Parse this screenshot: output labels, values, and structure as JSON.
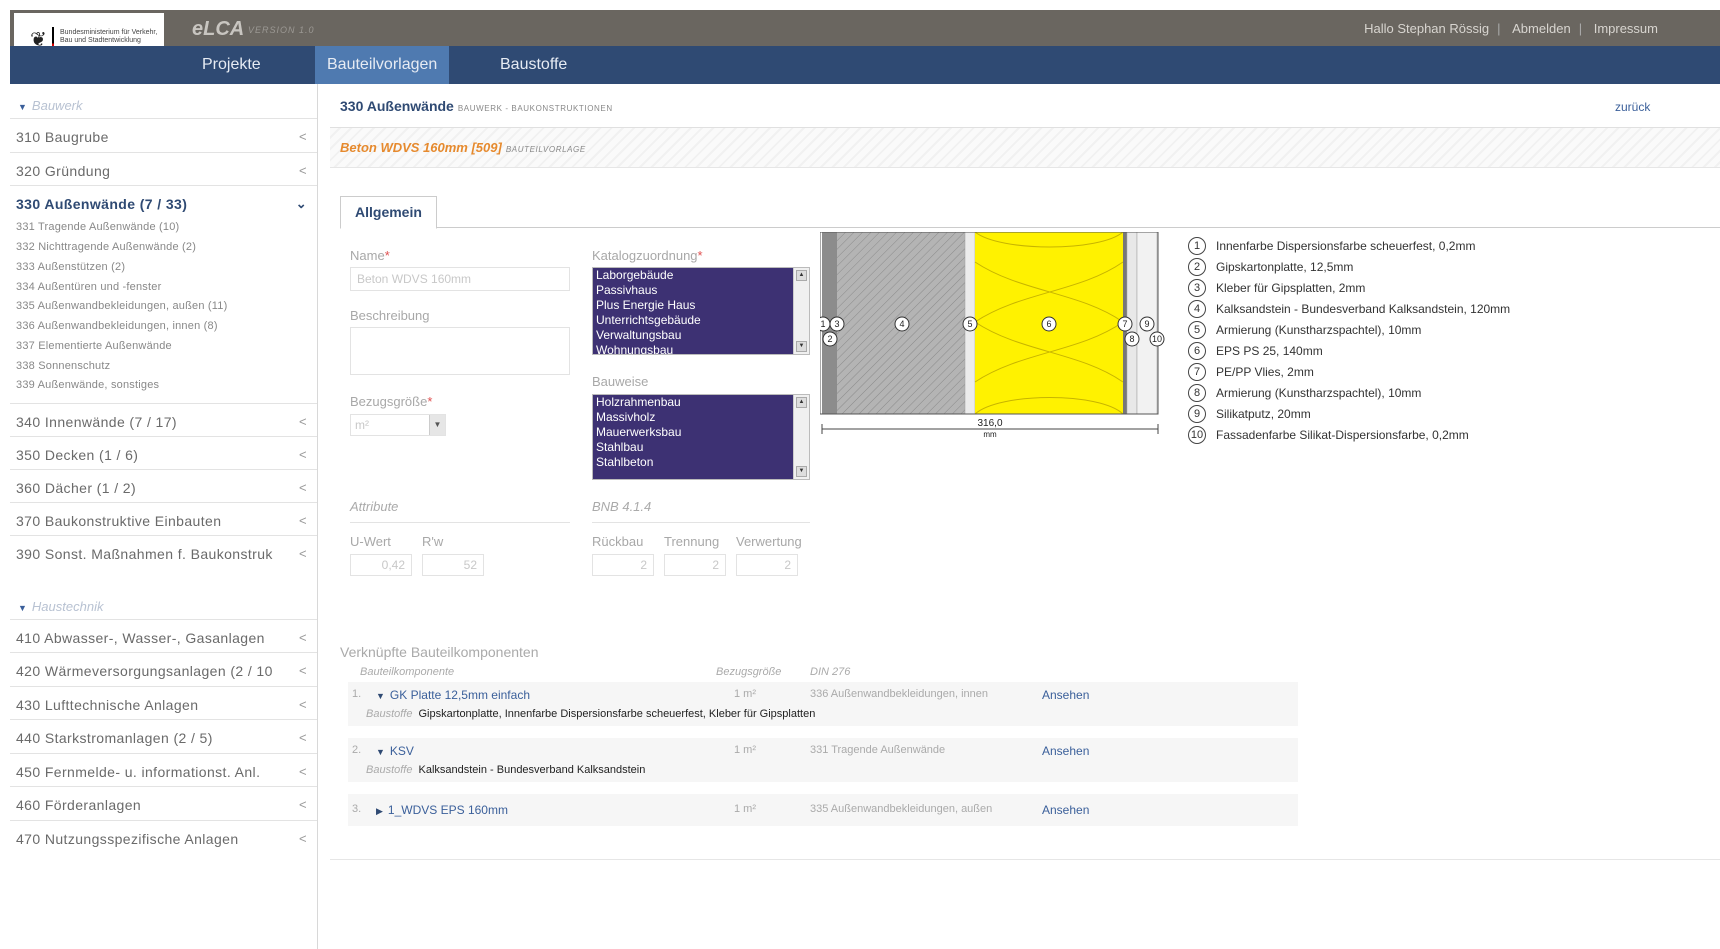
{
  "header": {
    "logo_text": "Bundesministerium für Verkehr, Bau und Stadtentwicklung",
    "logo_icon": "eagle-icon",
    "app_title": "eLCA",
    "app_version": "VERSION 1.0",
    "greeting": "Hallo Stephan Rössig",
    "logout": "Abmelden",
    "imprint": "Impressum"
  },
  "nav": {
    "projekte": "Projekte",
    "bauteilvorlagen": "Bauteilvorlagen",
    "baustoffe": "Baustoffe"
  },
  "sidebar": {
    "section1": "Bauwerk",
    "items1": [
      {
        "label": "310 Baugrube"
      },
      {
        "label": "320 Gründung"
      },
      {
        "label": "330 Außenwände (7 / 33)"
      }
    ],
    "subitems": [
      "331 Tragende Außenwände (10)",
      "332 Nichttragende Außenwände (2)",
      "333 Außenstützen (2)",
      "334 Außentüren und -fenster",
      "335 Außenwandbekleidungen, außen (11)",
      "336 Außenwandbekleidungen, innen (8)",
      "337 Elementierte Außenwände",
      "338 Sonnenschutz",
      "339 Außenwände, sonstiges"
    ],
    "items2": [
      {
        "label": "340 Innenwände (7 / 17)"
      },
      {
        "label": "350 Decken (1 / 6)"
      },
      {
        "label": "360 Dächer (1 / 2)"
      },
      {
        "label": "370 Baukonstruktive Einbauten"
      },
      {
        "label": "390 Sonst. Maßnahmen f. Baukonstruk"
      }
    ],
    "section2": "Haustechnik",
    "items3": [
      {
        "label": "410 Abwasser-, Wasser-, Gasanlagen"
      },
      {
        "label": "420 Wärmeversorgungsanlagen (2 / 10"
      },
      {
        "label": "430 Lufttechnische Anlagen"
      },
      {
        "label": "440 Starkstromanlagen (2 / 5)"
      },
      {
        "label": "450 Fernmelde- u. informationst. Anl."
      },
      {
        "label": "460 Förderanlagen"
      },
      {
        "label": "470 Nutzungsspezifische Anlagen"
      }
    ]
  },
  "breadcrumb": {
    "title": "330 Außenwände",
    "subtitle": "BAUWERK - BAUKONSTRUKTIONEN",
    "back": "zurück"
  },
  "template": {
    "title": "Beton WDVS 160mm [509]",
    "subtitle": "BAUTEILVORLAGE"
  },
  "tabs": {
    "allgemein": "Allgemein"
  },
  "form": {
    "name_label": "Name",
    "name_value": "Beton WDVS 160mm",
    "description_label": "Beschreibung",
    "unit_label": "Bezugsgröße",
    "unit_value": "m²",
    "catalog_label": "Katalogzuordnung",
    "catalog_options": [
      "Laborgebäude",
      "Passivhaus",
      "Plus Energie Haus",
      "Unterrichtsgebäude",
      "Verwaltungsbau",
      "Wohnungsbau"
    ],
    "construction_label": "Bauweise",
    "construction_options": [
      "Holzrahmenbau",
      "Massivholz",
      "Mauerwerksbau",
      "Stahlbau",
      "Stahlbeton"
    ],
    "required_mark": "*"
  },
  "attributes": {
    "header": "Attribute",
    "uwert_label": "U-Wert",
    "uwert_value": "0,42",
    "rw_label": "R'w",
    "rw_value": "52",
    "bnb_header": "BNB 4.1.4",
    "rueckbau_label": "Rückbau",
    "rueckbau_value": "2",
    "trennung_label": "Trennung",
    "trennung_value": "2",
    "verwertung_label": "Verwertung",
    "verwertung_value": "2"
  },
  "diagram": {
    "dimension_value": "316,0",
    "dimension_unit": "mm",
    "layer_colors": {
      "gray": "#8c8c8c",
      "concrete": "#b4b4b4",
      "white": "#ececec",
      "insulation": "#fff200"
    },
    "callouts": [
      "1",
      "2",
      "3",
      "4",
      "5",
      "6",
      "7",
      "8",
      "9",
      "10"
    ]
  },
  "legend": [
    {
      "num": "1",
      "text": "Innenfarbe Dispersionsfarbe scheuerfest, 0,2mm"
    },
    {
      "num": "2",
      "text": "Gipskartonplatte, 12,5mm"
    },
    {
      "num": "3",
      "text": "Kleber für Gipsplatten, 2mm"
    },
    {
      "num": "4",
      "text": "Kalksandstein - Bundesverband Kalksandstein, 120mm"
    },
    {
      "num": "5",
      "text": "Armierung (Kunstharzspachtel), 10mm"
    },
    {
      "num": "6",
      "text": "EPS PS 25, 140mm"
    },
    {
      "num": "7",
      "text": "PE/PP Vlies, 2mm"
    },
    {
      "num": "8",
      "text": "Armierung (Kunstharzspachtel), 10mm"
    },
    {
      "num": "9",
      "text": "Silikatputz, 20mm"
    },
    {
      "num": "10",
      "text": "Fassadenfarbe Silikat-Dispersionsfarbe, 0,2mm"
    }
  ],
  "components": {
    "title": "Verknüpfte Bauteilkomponenten",
    "col_component": "Bauteilkomponente",
    "col_unit": "Bezugsgröße",
    "col_din": "DIN 276",
    "materials_label": "Baustoffe",
    "rows": [
      {
        "num": "1.",
        "name": "GK Platte 12,5mm einfach",
        "qty": "1  m²",
        "din": "336 Außenwandbekleidungen, innen",
        "view": "Ansehen",
        "materials": "Gipskartonplatte, Innenfarbe Dispersionsfarbe scheuerfest, Kleber für Gipsplatten"
      },
      {
        "num": "2.",
        "name": "KSV",
        "qty": "1  m²",
        "din": "331 Tragende Außenwände",
        "view": "Ansehen",
        "materials": "Kalksandstein - Bundesverband Kalksandstein"
      },
      {
        "num": "3.",
        "name": "1_WDVS EPS 160mm",
        "qty": "1  m²",
        "din": "335 Außenwandbekleidungen, außen",
        "view": "Ansehen"
      }
    ]
  }
}
